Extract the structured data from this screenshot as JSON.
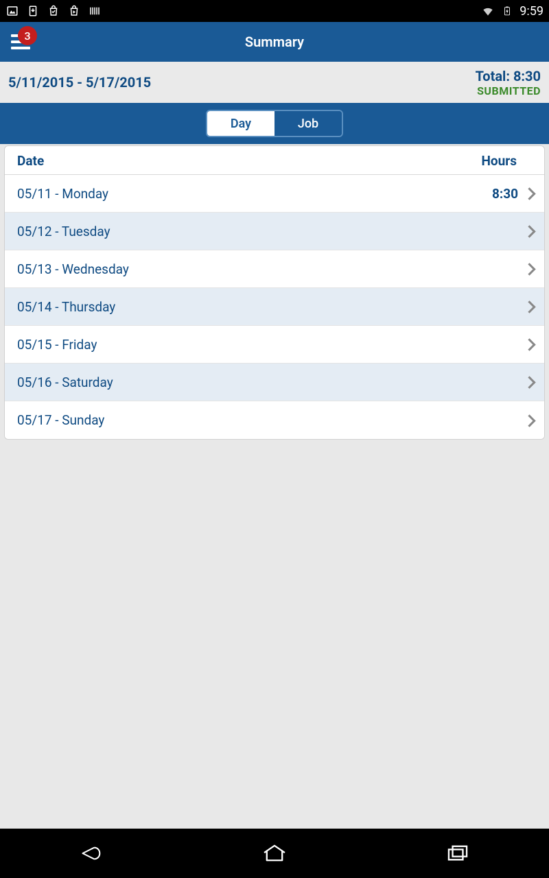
{
  "status_bar": {
    "time": "9:59"
  },
  "header": {
    "title": "Summary",
    "badge_count": "3"
  },
  "subheader": {
    "date_range": "5/11/2015 - 5/17/2015",
    "total_label": "Total: 8:30",
    "status": "SUBMITTED"
  },
  "tabs": {
    "day": "Day",
    "job": "Job",
    "active": "day"
  },
  "columns": {
    "date": "Date",
    "hours": "Hours"
  },
  "rows": [
    {
      "date": "05/11 - Monday",
      "hours": "8:30"
    },
    {
      "date": "05/12 - Tuesday",
      "hours": ""
    },
    {
      "date": "05/13 - Wednesday",
      "hours": ""
    },
    {
      "date": "05/14 - Thursday",
      "hours": ""
    },
    {
      "date": "05/15 - Friday",
      "hours": ""
    },
    {
      "date": "05/16 - Saturday",
      "hours": ""
    },
    {
      "date": "05/17 - Sunday",
      "hours": ""
    }
  ]
}
